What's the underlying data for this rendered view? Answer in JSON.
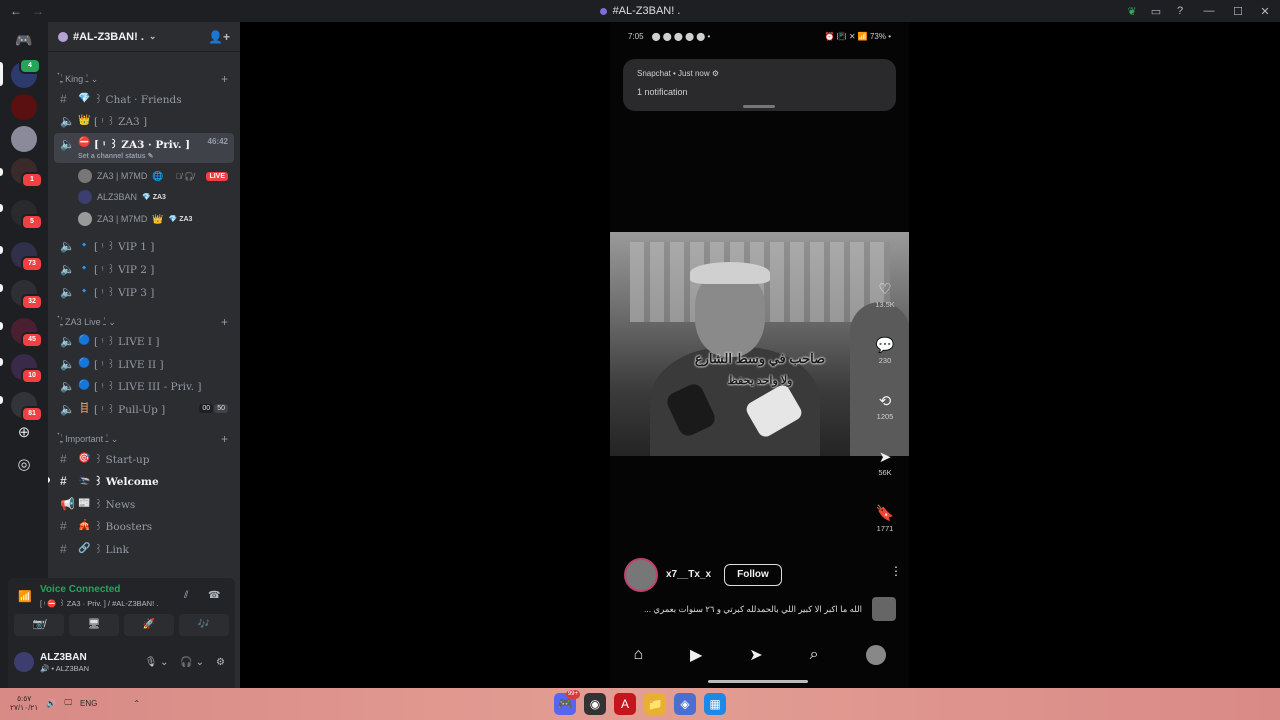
{
  "titlebar": {
    "back": "←",
    "forward": "→",
    "title": "#AL-Z3BAN! .",
    "icons": [
      "leaf-icon",
      "inbox-icon",
      "help-icon"
    ],
    "minimize": "—",
    "maximize": "☐",
    "close": "✕"
  },
  "rail": {
    "badges": [
      "4",
      "1",
      "5",
      "73",
      "32",
      "45",
      "10",
      "81"
    ]
  },
  "guild": {
    "name": "#AL-Z3BAN! .",
    "chevron": "⌄",
    "invite_icon": "👤+"
  },
  "categories": {
    "king": "ـِٰ๋ King ـٰ ⌄",
    "live": "ـِٰ๋ ZA3 Live ـٰ ⌄",
    "important": "ـِٰ๋ Important ـٰ ⌄",
    "plus": "+"
  },
  "channels": {
    "chat": {
      "emoji": "💎",
      "name": "꒱ Chat · Friends"
    },
    "za3": {
      "emoji": "👑",
      "name": "[ ᵎ ꒱ ZA3 ]"
    },
    "priv": {
      "emoji": "⛔",
      "name": "[ ᵎ ꒱ ZA3 · Priv. ]",
      "timer": "46:42",
      "status": "Set a channel status ✎"
    },
    "vip1": {
      "emoji": "🔹",
      "name": "[ ᵎ ꒱ VIP 1 ]"
    },
    "vip2": {
      "emoji": "🔹",
      "name": "[ ᵎ ꒱ VIP 2 ]"
    },
    "vip3": {
      "emoji": "🔹",
      "name": "[ ᵎ ꒱ VIP 3 ]"
    },
    "live1": {
      "emoji": "🔵",
      "name": "[ ᵎ ꒱ LIVE I ]"
    },
    "live2": {
      "emoji": "🔵",
      "name": "[ ᵎ ꒱ LIVE II ]"
    },
    "live3": {
      "emoji": "🔵",
      "name": "[ ᵎ ꒱ LIVE III - Priv. ]"
    },
    "pullup": {
      "emoji": "🪜",
      "name": "[ ᵎ ꒱ Pull-Up ]",
      "count_a": "00",
      "count_b": "50"
    },
    "startup": {
      "emoji": "🎯",
      "name": "꒱ Start-up"
    },
    "welcome": {
      "emoji": "🛬",
      "name": "꒱ Welcome"
    },
    "news": {
      "emoji": "📰",
      "name": "꒱ News"
    },
    "boosters": {
      "emoji": "🎪",
      "name": "꒱ Boosters"
    },
    "link": {
      "emoji": "🔗",
      "name": "꒱ Link"
    }
  },
  "voice_users": [
    {
      "name": "ZA3 | M7MD",
      "extra": "🌐",
      "mic": "🎙̸ 🎧̸",
      "live": "LIVE"
    },
    {
      "name": "ALZ3BAN",
      "tag": "💎 ZA3"
    },
    {
      "name": "ZA3 | M7MD",
      "extra": "👑",
      "tag": "💎 ZA3"
    }
  ],
  "voice_panel": {
    "status": "Voice Connected",
    "channel": "[ ᵎ ⛔ ꒱ ZA3 · Priv. ] / #AL-Z3BAN! .",
    "buttons": [
      "📷̸",
      "🖥",
      "🚀",
      "🎶"
    ]
  },
  "user": {
    "name": "ALZ3BAN",
    "sub": "🔊 • ALZ3BAN",
    "controls": [
      "🎙 ⌄",
      "🎧 ⌄",
      "⚙"
    ]
  },
  "phone": {
    "time": "7:05",
    "status_left_icons": "⬤ ⬤ ⬤ ⬤ ⬤ •",
    "status_right": "⏰ 📳 ✕ 📶 73% •",
    "notification_top": "Snapchat • Just now ⚙",
    "notification_body": "1 notification",
    "subtitle_line1": "صاحب في وسط الشارع",
    "subtitle_line2": "ولا واحد يحفظ",
    "actions": [
      {
        "icon": "♡",
        "label": "13.5K",
        "name": "like-icon"
      },
      {
        "icon": "💬",
        "label": "230",
        "name": "comment-icon"
      },
      {
        "icon": "⟲",
        "label": "1205",
        "name": "repost-icon"
      },
      {
        "icon": "➤",
        "label": "56K",
        "name": "share-icon"
      },
      {
        "icon": "🔖",
        "label": "1771",
        "name": "save-icon"
      }
    ],
    "author": "x7__Tx_x",
    "follow": "Follow",
    "more": "⋮",
    "caption": "... الله ما اكبر الا كبير اللي بالحمدلله كبرتي و ٢٦ سنوات بعمري",
    "nav": [
      "⌂",
      "▶",
      "➤",
      "⌕"
    ]
  },
  "taskbar": {
    "clock_time": "٥:٥٧",
    "clock_date": "٢٧/١٠/٢١",
    "lang": "ENG",
    "apps": [
      {
        "name": "discord-app",
        "icon": "🎮",
        "badge": "99+",
        "color": "#5865f2"
      },
      {
        "name": "obs-app",
        "icon": "◉",
        "color": "#333333"
      },
      {
        "name": "acrobat-app",
        "icon": "A",
        "color": "#c4161c"
      },
      {
        "name": "files-app",
        "icon": "📁",
        "color": "#e8b030"
      },
      {
        "name": "capcut-app",
        "icon": "◈",
        "color": "#4a6fd0"
      },
      {
        "name": "store-app",
        "icon": "▦",
        "color": "#1e88e5"
      }
    ]
  }
}
